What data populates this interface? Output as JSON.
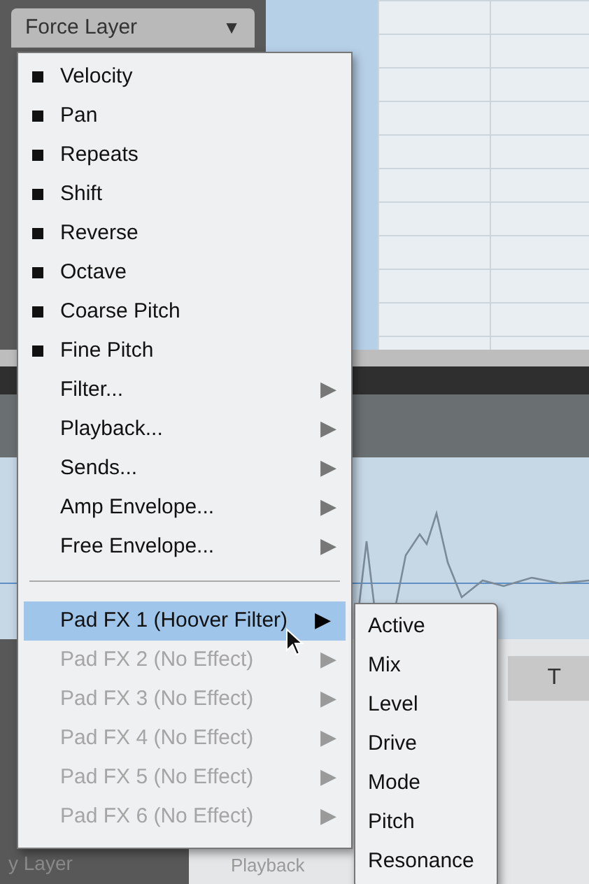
{
  "dropdown": {
    "label": "Force Layer",
    "arrow": "▼"
  },
  "menu": {
    "items": [
      {
        "kind": "check",
        "label": "Velocity",
        "checked": true
      },
      {
        "kind": "check",
        "label": "Pan",
        "checked": true
      },
      {
        "kind": "check",
        "label": "Repeats",
        "checked": true
      },
      {
        "kind": "check",
        "label": "Shift",
        "checked": true
      },
      {
        "kind": "check",
        "label": "Reverse",
        "checked": true
      },
      {
        "kind": "check",
        "label": "Octave",
        "checked": true
      },
      {
        "kind": "check",
        "label": "Coarse Pitch",
        "checked": true
      },
      {
        "kind": "check",
        "label": "Fine Pitch",
        "checked": true
      },
      {
        "kind": "submenu",
        "label": "Filter...",
        "arrow": "▶"
      },
      {
        "kind": "submenu",
        "label": "Playback...",
        "arrow": "▶"
      },
      {
        "kind": "submenu",
        "label": "Sends...",
        "arrow": "▶"
      },
      {
        "kind": "submenu",
        "label": "Amp Envelope...",
        "arrow": "▶"
      },
      {
        "kind": "submenu",
        "label": "Free Envelope...",
        "arrow": "▶"
      }
    ],
    "fx_items": [
      {
        "label": "Pad FX 1 (Hoover Filter)",
        "arrow": "▶",
        "selected": true,
        "disabled": false
      },
      {
        "label": "Pad FX 2 (No Effect)",
        "arrow": "▶",
        "selected": false,
        "disabled": true
      },
      {
        "label": "Pad FX 3 (No Effect)",
        "arrow": "▶",
        "selected": false,
        "disabled": true
      },
      {
        "label": "Pad FX 4 (No Effect)",
        "arrow": "▶",
        "selected": false,
        "disabled": true
      },
      {
        "label": "Pad FX 5 (No Effect)",
        "arrow": "▶",
        "selected": false,
        "disabled": true
      },
      {
        "label": "Pad FX 6 (No Effect)",
        "arrow": "▶",
        "selected": false,
        "disabled": true
      }
    ]
  },
  "submenu": {
    "items": [
      "Active",
      "Mix",
      "Level",
      "Drive",
      "Mode",
      "Pitch",
      "Resonance"
    ]
  },
  "background": {
    "tab_label": "T",
    "layer_label": "y Layer",
    "playback_label": "Playback"
  }
}
